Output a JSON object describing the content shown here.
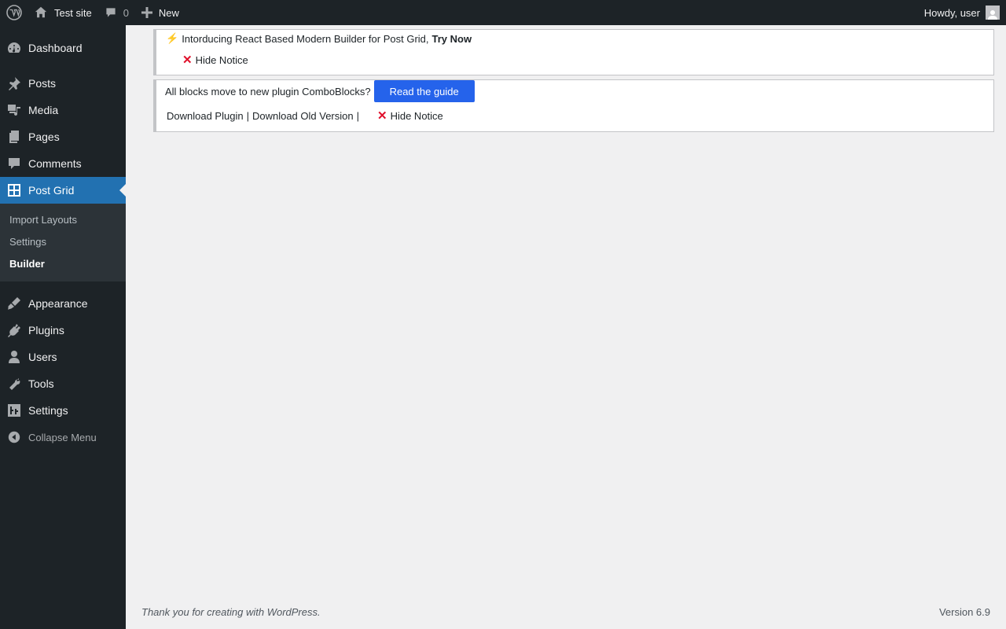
{
  "adminbar": {
    "site_name": "Test site",
    "comments_count": "0",
    "new_label": "New",
    "howdy": "Howdy, user"
  },
  "sidebar": {
    "items": [
      {
        "label": "Dashboard",
        "icon": "dashboard-icon"
      },
      {
        "label": "Posts",
        "icon": "pin-icon"
      },
      {
        "label": "Media",
        "icon": "media-icon"
      },
      {
        "label": "Pages",
        "icon": "pages-icon"
      },
      {
        "label": "Comments",
        "icon": "comment-icon"
      },
      {
        "label": "Post Grid",
        "icon": "grid-icon"
      }
    ],
    "submenu": [
      {
        "label": "Import Layouts"
      },
      {
        "label": "Settings"
      },
      {
        "label": "Builder"
      }
    ],
    "items_after": [
      {
        "label": "Appearance",
        "icon": "brush-icon"
      },
      {
        "label": "Plugins",
        "icon": "plug-icon"
      },
      {
        "label": "Users",
        "icon": "user-icon"
      },
      {
        "label": "Tools",
        "icon": "wrench-icon"
      },
      {
        "label": "Settings",
        "icon": "settings-icon"
      }
    ],
    "collapse_label": "Collapse Menu"
  },
  "notice1": {
    "bolt": "⚡",
    "text": "Intorducing React Based Modern Builder for Post Grid,",
    "link": "Try Now",
    "hide_label": "Hide Notice"
  },
  "notice2": {
    "text": "All blocks move to new plugin ComboBlocks?",
    "button_label": "Read the guide",
    "download_plugin": "Download Plugin",
    "separator1": "|",
    "download_old": "Download Old Version",
    "separator2": "|",
    "hide_label": "Hide Notice"
  },
  "footer": {
    "left": "Thank you for creating with WordPress.",
    "version": "Version 6.9"
  },
  "colors": {
    "menu_bg": "#1d2327",
    "submenu_bg": "#2c3338",
    "current": "#2271b1",
    "button": "#2563eb",
    "hide_x": "#e0102b"
  }
}
